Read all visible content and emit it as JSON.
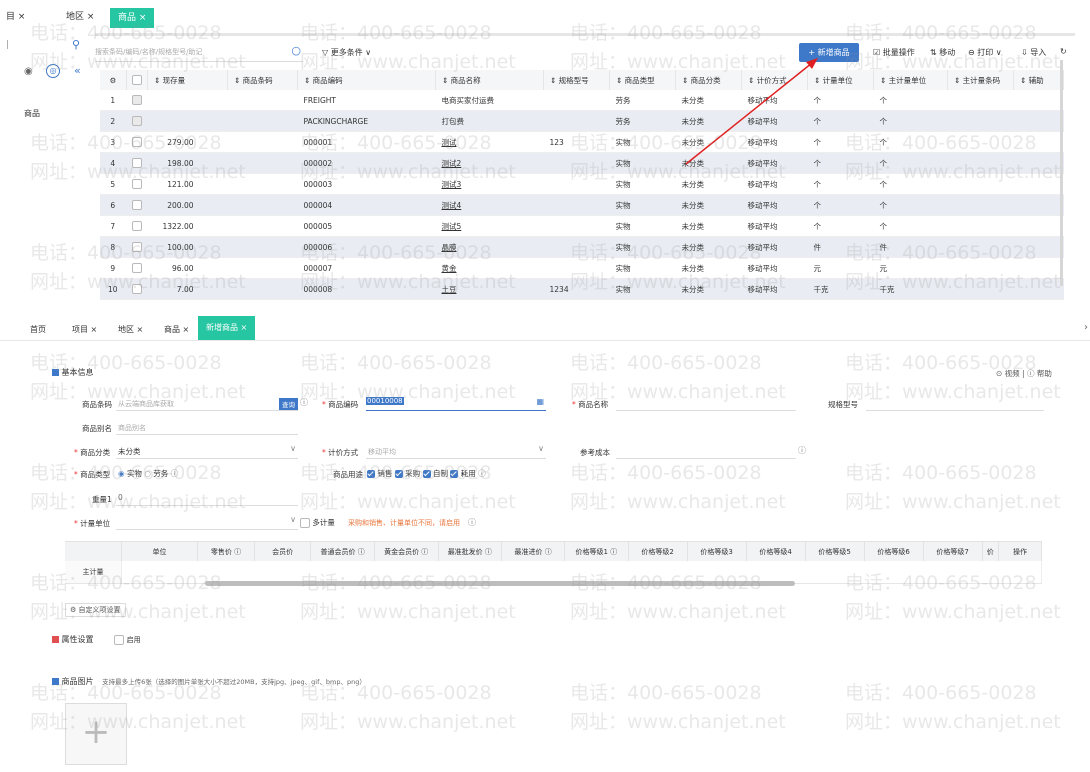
{
  "top": {
    "tabs": [
      "目 ×",
      "地区 ×",
      "商品 ×"
    ],
    "search_placeholder": "搜索条码/编码/名称/规格型号/助记",
    "more_conditions": "更多条件",
    "new_button": "+ 新增商品",
    "batch": "批量操作",
    "move": "移动",
    "print": "打印",
    "import": "导入",
    "left_nav_label": "商品",
    "columns": [
      "现存量",
      "商品条码",
      "商品编码",
      "商品名称",
      "规格型号",
      "商品类型",
      "商品分类",
      "计价方式",
      "计量单位",
      "主计量单位",
      "主计量条码",
      "辅助"
    ],
    "rows": [
      {
        "no": "1",
        "qty": "",
        "barcode": "",
        "code": "FREIGHT",
        "name": "电商买家付运费",
        "spec": "",
        "type": "劳务",
        "cat": "未分类",
        "price": "移动平均",
        "unit": "个",
        "munit": "个"
      },
      {
        "no": "2",
        "qty": "",
        "barcode": "",
        "code": "PACKINGCHARGE",
        "name": "打包费",
        "spec": "",
        "type": "劳务",
        "cat": "未分类",
        "price": "移动平均",
        "unit": "个",
        "munit": "个"
      },
      {
        "no": "3",
        "qty": "279.00",
        "barcode": "",
        "code": "000001",
        "name": "测试",
        "spec": "123",
        "type": "实物",
        "cat": "未分类",
        "price": "移动平均",
        "unit": "个",
        "munit": "个"
      },
      {
        "no": "4",
        "qty": "198.00",
        "barcode": "",
        "code": "000002",
        "name": "测试2",
        "spec": "",
        "type": "实物",
        "cat": "未分类",
        "price": "移动平均",
        "unit": "个",
        "munit": "个"
      },
      {
        "no": "5",
        "qty": "121.00",
        "barcode": "",
        "code": "000003",
        "name": "测试3",
        "spec": "",
        "type": "实物",
        "cat": "未分类",
        "price": "移动平均",
        "unit": "个",
        "munit": "个"
      },
      {
        "no": "6",
        "qty": "200.00",
        "barcode": "",
        "code": "000004",
        "name": "测试4",
        "spec": "",
        "type": "实物",
        "cat": "未分类",
        "price": "移动平均",
        "unit": "个",
        "munit": "个"
      },
      {
        "no": "7",
        "qty": "1322.00",
        "barcode": "",
        "code": "000005",
        "name": "测试5",
        "spec": "",
        "type": "实物",
        "cat": "未分类",
        "price": "移动平均",
        "unit": "个",
        "munit": "个"
      },
      {
        "no": "8",
        "qty": "100.00",
        "barcode": "",
        "code": "000006",
        "name": "晶膜",
        "spec": "",
        "type": "实物",
        "cat": "未分类",
        "price": "移动平均",
        "unit": "件",
        "munit": "件"
      },
      {
        "no": "9",
        "qty": "96.00",
        "barcode": "",
        "code": "000007",
        "name": "黄金",
        "spec": "",
        "type": "实物",
        "cat": "未分类",
        "price": "移动平均",
        "unit": "元",
        "munit": "元"
      },
      {
        "no": "10",
        "qty": "7.00",
        "barcode": "",
        "code": "000008",
        "name": "土豆",
        "spec": "1234",
        "type": "实物",
        "cat": "未分类",
        "price": "移动平均",
        "unit": "千克",
        "munit": "千克"
      }
    ]
  },
  "bottom": {
    "tabs": [
      "首页",
      "项目 ×",
      "地区 ×",
      "商品 ×",
      "新增商品 ×"
    ],
    "section_basic": "基本信息",
    "video_help": "⊙ 视频 | ⓘ 帮助",
    "barcode_label": "商品条码",
    "barcode_placeholder": "从云端商品库获取",
    "query_btn": "查询",
    "code_label": "商品编码",
    "code_value": "00010008",
    "name_label": "商品名称",
    "spec_label": "规格型号",
    "alias_label": "商品别名",
    "alias_placeholder": "商品别名",
    "category_label": "商品分类",
    "category_value": "未分类",
    "pricing_label": "计价方式",
    "pricing_value": "移动平均",
    "refcost_label": "参考成本",
    "type_label": "商品类型",
    "type_opt1": "实物",
    "type_opt2": "劳务",
    "usage_label": "商品用途",
    "usage_opts": [
      "销售",
      "采购",
      "自制",
      "耗用"
    ],
    "weight_label": "重量1",
    "weight_value": "0",
    "unit_label": "计量单位",
    "multi_unit": "多计量",
    "unit_hint": "采购和销售、计量单位不同，请启用",
    "price_columns": [
      "单位",
      "零售价 ⓘ",
      "会员价",
      "普通会员价 ⓘ",
      "黄金会员价 ⓘ",
      "最准批发价 ⓘ",
      "最准进价 ⓘ",
      "价格等级1 ⓘ",
      "价格等级2",
      "价格等级3",
      "价格等级4",
      "价格等级5",
      "价格等级6",
      "价格等级7",
      "价",
      "操作"
    ],
    "main_unit_row": "主计量",
    "custom_cols": "自定义项设置",
    "attr_label": "属性设置",
    "attr_enable": "启用",
    "image_label": "商品图片",
    "image_hint": "支持最多上传6张（选择的图片单张大小不超过20MB，支持jpg、jpeg、gif、bmp、png）",
    "upload_plus": "+"
  },
  "watermark": {
    "phone": "电话：400-665-0028",
    "site": "网址：www.chanjet.net"
  },
  "colors": {
    "accent": "#26c6a2",
    "primary": "#3e78c9",
    "arrow": "#e02020",
    "hint": "#e8743b"
  }
}
